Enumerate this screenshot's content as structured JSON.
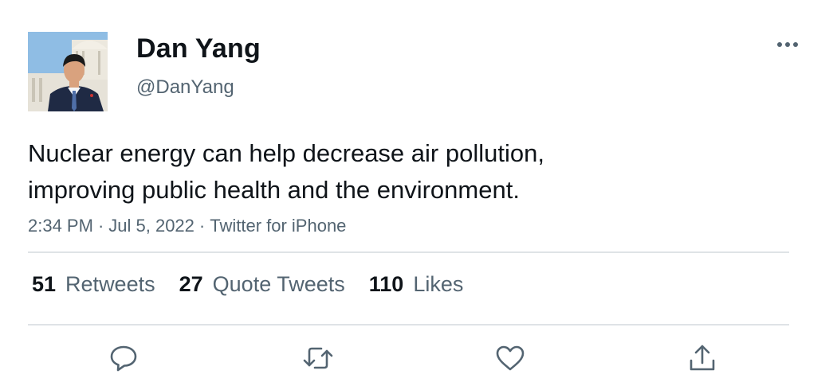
{
  "author": {
    "display_name": "Dan Yang",
    "handle": "@DanYang"
  },
  "tweet": {
    "text_lines": [
      "Nuclear energy can help decrease air pollution,",
      "improving public health and the environment."
    ],
    "time": "2:34 PM",
    "date": "Jul 5, 2022",
    "source": "Twitter for iPhone",
    "separator": "·"
  },
  "stats": {
    "retweets": {
      "count": "51",
      "label": "Retweets"
    },
    "quote_tweets": {
      "count": "27",
      "label": "Quote Tweets"
    },
    "likes": {
      "count": "110",
      "label": "Likes"
    }
  },
  "actions": [
    "reply-icon",
    "retweet-icon",
    "like-icon",
    "share-icon"
  ],
  "icons": {
    "more": "more-dots-icon"
  },
  "colors": {
    "text_primary": "#0f1419",
    "text_secondary": "#536471",
    "divider": "#dfe3e6"
  }
}
